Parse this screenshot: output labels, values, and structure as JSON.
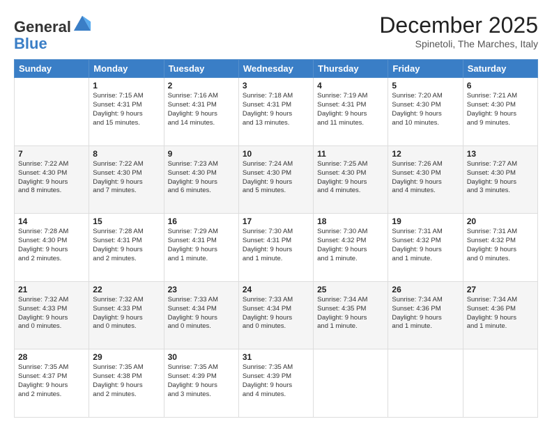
{
  "logo": {
    "general": "General",
    "blue": "Blue"
  },
  "header": {
    "month": "December 2025",
    "location": "Spinetoli, The Marches, Italy"
  },
  "days_of_week": [
    "Sunday",
    "Monday",
    "Tuesday",
    "Wednesday",
    "Thursday",
    "Friday",
    "Saturday"
  ],
  "weeks": [
    [
      {
        "day": "",
        "info": ""
      },
      {
        "day": "1",
        "info": "Sunrise: 7:15 AM\nSunset: 4:31 PM\nDaylight: 9 hours\nand 15 minutes."
      },
      {
        "day": "2",
        "info": "Sunrise: 7:16 AM\nSunset: 4:31 PM\nDaylight: 9 hours\nand 14 minutes."
      },
      {
        "day": "3",
        "info": "Sunrise: 7:18 AM\nSunset: 4:31 PM\nDaylight: 9 hours\nand 13 minutes."
      },
      {
        "day": "4",
        "info": "Sunrise: 7:19 AM\nSunset: 4:31 PM\nDaylight: 9 hours\nand 11 minutes."
      },
      {
        "day": "5",
        "info": "Sunrise: 7:20 AM\nSunset: 4:30 PM\nDaylight: 9 hours\nand 10 minutes."
      },
      {
        "day": "6",
        "info": "Sunrise: 7:21 AM\nSunset: 4:30 PM\nDaylight: 9 hours\nand 9 minutes."
      }
    ],
    [
      {
        "day": "7",
        "info": "Sunrise: 7:22 AM\nSunset: 4:30 PM\nDaylight: 9 hours\nand 8 minutes."
      },
      {
        "day": "8",
        "info": "Sunrise: 7:22 AM\nSunset: 4:30 PM\nDaylight: 9 hours\nand 7 minutes."
      },
      {
        "day": "9",
        "info": "Sunrise: 7:23 AM\nSunset: 4:30 PM\nDaylight: 9 hours\nand 6 minutes."
      },
      {
        "day": "10",
        "info": "Sunrise: 7:24 AM\nSunset: 4:30 PM\nDaylight: 9 hours\nand 5 minutes."
      },
      {
        "day": "11",
        "info": "Sunrise: 7:25 AM\nSunset: 4:30 PM\nDaylight: 9 hours\nand 4 minutes."
      },
      {
        "day": "12",
        "info": "Sunrise: 7:26 AM\nSunset: 4:30 PM\nDaylight: 9 hours\nand 4 minutes."
      },
      {
        "day": "13",
        "info": "Sunrise: 7:27 AM\nSunset: 4:30 PM\nDaylight: 9 hours\nand 3 minutes."
      }
    ],
    [
      {
        "day": "14",
        "info": "Sunrise: 7:28 AM\nSunset: 4:30 PM\nDaylight: 9 hours\nand 2 minutes."
      },
      {
        "day": "15",
        "info": "Sunrise: 7:28 AM\nSunset: 4:31 PM\nDaylight: 9 hours\nand 2 minutes."
      },
      {
        "day": "16",
        "info": "Sunrise: 7:29 AM\nSunset: 4:31 PM\nDaylight: 9 hours\nand 1 minute."
      },
      {
        "day": "17",
        "info": "Sunrise: 7:30 AM\nSunset: 4:31 PM\nDaylight: 9 hours\nand 1 minute."
      },
      {
        "day": "18",
        "info": "Sunrise: 7:30 AM\nSunset: 4:32 PM\nDaylight: 9 hours\nand 1 minute."
      },
      {
        "day": "19",
        "info": "Sunrise: 7:31 AM\nSunset: 4:32 PM\nDaylight: 9 hours\nand 1 minute."
      },
      {
        "day": "20",
        "info": "Sunrise: 7:31 AM\nSunset: 4:32 PM\nDaylight: 9 hours\nand 0 minutes."
      }
    ],
    [
      {
        "day": "21",
        "info": "Sunrise: 7:32 AM\nSunset: 4:33 PM\nDaylight: 9 hours\nand 0 minutes."
      },
      {
        "day": "22",
        "info": "Sunrise: 7:32 AM\nSunset: 4:33 PM\nDaylight: 9 hours\nand 0 minutes."
      },
      {
        "day": "23",
        "info": "Sunrise: 7:33 AM\nSunset: 4:34 PM\nDaylight: 9 hours\nand 0 minutes."
      },
      {
        "day": "24",
        "info": "Sunrise: 7:33 AM\nSunset: 4:34 PM\nDaylight: 9 hours\nand 0 minutes."
      },
      {
        "day": "25",
        "info": "Sunrise: 7:34 AM\nSunset: 4:35 PM\nDaylight: 9 hours\nand 1 minute."
      },
      {
        "day": "26",
        "info": "Sunrise: 7:34 AM\nSunset: 4:36 PM\nDaylight: 9 hours\nand 1 minute."
      },
      {
        "day": "27",
        "info": "Sunrise: 7:34 AM\nSunset: 4:36 PM\nDaylight: 9 hours\nand 1 minute."
      }
    ],
    [
      {
        "day": "28",
        "info": "Sunrise: 7:35 AM\nSunset: 4:37 PM\nDaylight: 9 hours\nand 2 minutes."
      },
      {
        "day": "29",
        "info": "Sunrise: 7:35 AM\nSunset: 4:38 PM\nDaylight: 9 hours\nand 2 minutes."
      },
      {
        "day": "30",
        "info": "Sunrise: 7:35 AM\nSunset: 4:39 PM\nDaylight: 9 hours\nand 3 minutes."
      },
      {
        "day": "31",
        "info": "Sunrise: 7:35 AM\nSunset: 4:39 PM\nDaylight: 9 hours\nand 4 minutes."
      },
      {
        "day": "",
        "info": ""
      },
      {
        "day": "",
        "info": ""
      },
      {
        "day": "",
        "info": ""
      }
    ]
  ]
}
